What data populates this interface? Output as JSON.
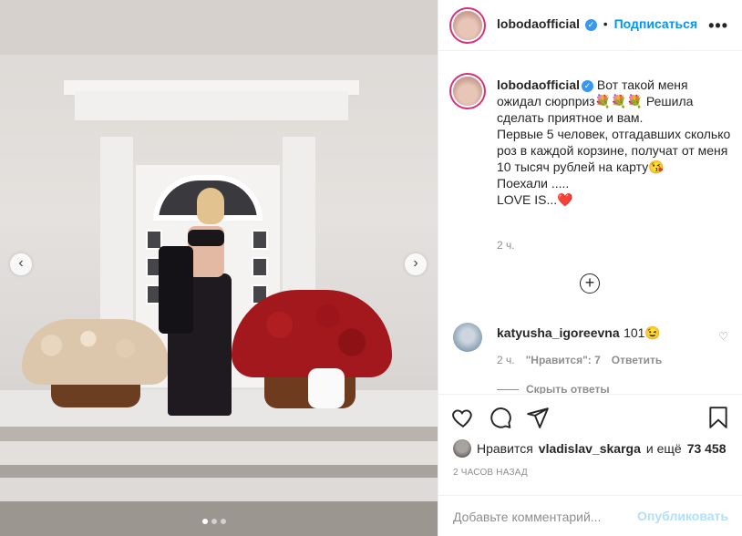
{
  "post": {
    "author": "lobodaofficial",
    "follow_label": "Подписаться",
    "more_icon": "more-horizontal-icon"
  },
  "caption": {
    "author": "lobodaofficial",
    "text": "Вот такой меня ожидал сюрприз💐💐💐 Решила сделать приятное и вам.\nПервые 5 человек, отгадавших сколько роз в каждой корзине, получат от меня 10 тысяч рублей на карту😘\nПоехали .....\nLOVE IS...❤️",
    "time": "2 ч."
  },
  "load_more_icon": "plus-circle-icon",
  "comments": [
    {
      "user": "katyusha_igoreevna",
      "text": "101😉",
      "time": "2 ч.",
      "likes": "\"Нравится\": 7",
      "reply_label": "Ответить",
      "hide_replies": "Скрыть ответы"
    }
  ],
  "actions": {
    "like_icon": "heart-icon",
    "comment_icon": "comment-icon",
    "share_icon": "send-icon",
    "save_icon": "bookmark-icon"
  },
  "likes": {
    "prefix": "Нравится",
    "user": "vladislav_skarga",
    "suffix": "и ещё",
    "count": "73 458"
  },
  "timestamp": "2 ЧАСОВ НАЗАД",
  "comment_box": {
    "placeholder": "Добавьте комментарий...",
    "publish_label": "Опубликовать"
  },
  "carousel": {
    "current": 1,
    "total": 3
  },
  "colors": {
    "accent": "#0095f6",
    "publish_disabled": "#b2dffc",
    "verified": "#3897f0"
  }
}
